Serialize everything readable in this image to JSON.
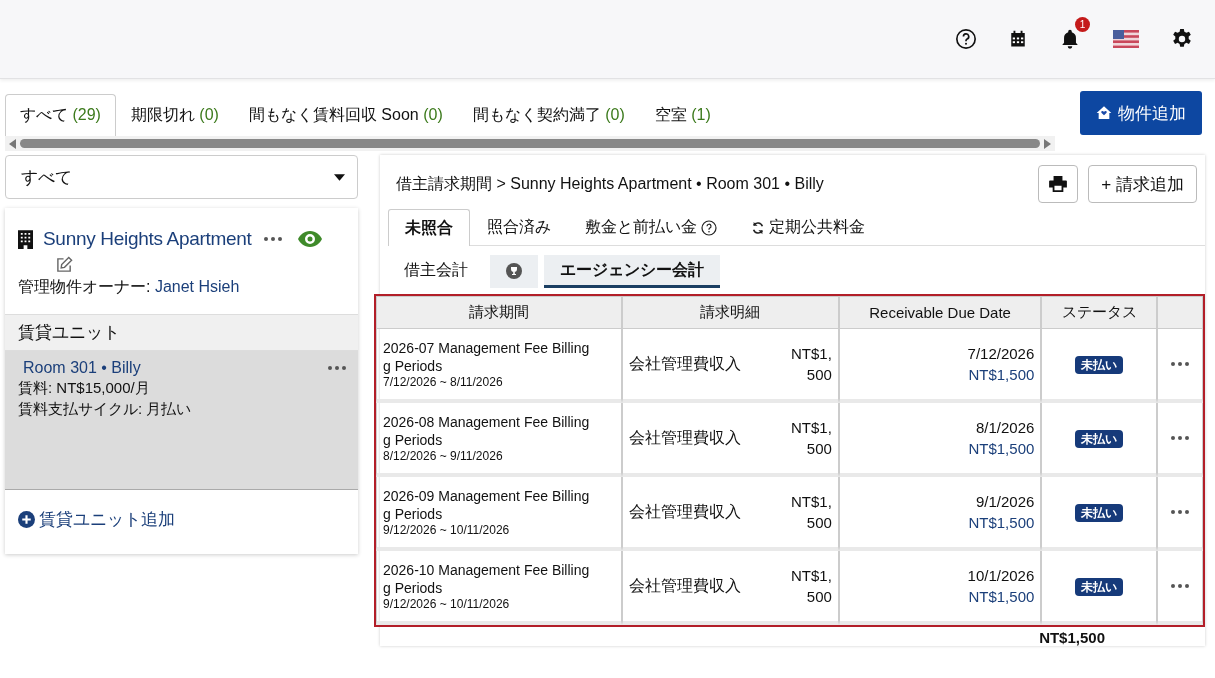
{
  "header": {
    "notification_count": "1"
  },
  "filter_tabs": [
    {
      "label": "すべて",
      "count": "(29)",
      "selected": true
    },
    {
      "label": "期限切れ",
      "count": "(0)",
      "selected": false
    },
    {
      "label": "間もなく賃料回収 Soon",
      "count": "(0)",
      "selected": false
    },
    {
      "label": "間もなく契約満了",
      "count": "(0)",
      "selected": false
    },
    {
      "label": "空室",
      "count": "(1)",
      "selected": false
    }
  ],
  "add_property_button": "物件追加",
  "sidebar": {
    "filter_select": {
      "value": "すべて"
    },
    "property": {
      "name": "Sunny Heights Apartment",
      "owner_label": "管理物件オーナー:",
      "owner_name": "Janet Hsieh",
      "visible": true
    },
    "units_heading": "賃貸ユニット",
    "units": [
      {
        "title": "Room 301 • Billy",
        "rent": "賃料: NT$15,000/月",
        "cycle": "賃料支払サイクル: 月払い",
        "selected": true
      }
    ],
    "add_unit_link": "賃貸ユニット追加"
  },
  "panel": {
    "breadcrumb": "借主請求期間 > Sunny Heights Apartment • Room 301 • Billy",
    "add_bill_button": "+ 請求追加",
    "tabs": [
      {
        "label": "未照合",
        "kind": "plain",
        "selected": true
      },
      {
        "label": "照合済み",
        "kind": "plain",
        "selected": false
      },
      {
        "label": "敷金と前払い金",
        "kind": "help",
        "selected": false
      },
      {
        "label": "定期公共料金",
        "kind": "refresh",
        "selected": false
      }
    ],
    "subtabs": [
      {
        "label": "借主会計",
        "kind": "text",
        "selected": false
      },
      {
        "kind": "icon",
        "selected": false
      },
      {
        "label": "エージェンシー会計",
        "kind": "text",
        "selected": true
      }
    ],
    "table": {
      "columns": [
        "請求期間",
        "請求明細",
        "Receivable Due Date",
        "ステータス"
      ],
      "rows": [
        {
          "title": "2026-07 Management Fee Billing\ng Periods",
          "range": "7/12/2026 ~ 8/11/2026",
          "item": "会社管理費収入",
          "amount": "NT$1,\n500",
          "due_date": "7/12/2026",
          "due_amount": "NT$1,500",
          "status": "未払い"
        },
        {
          "title": "2026-08 Management Fee Billing\ng Periods",
          "range": "8/12/2026 ~ 9/11/2026",
          "item": "会社管理費収入",
          "amount": "NT$1,\n500",
          "due_date": "8/1/2026",
          "due_amount": "NT$1,500",
          "status": "未払い"
        },
        {
          "title": "2026-09 Management Fee Billing\ng Periods",
          "range": "9/12/2026 ~ 10/11/2026",
          "item": "会社管理費収入",
          "amount": "NT$1,\n500",
          "due_date": "9/1/2026",
          "due_amount": "NT$1,500",
          "status": "未払い"
        },
        {
          "title": "2026-10 Management Fee Billing\ng Periods",
          "range": "9/12/2026 ~ 10/11/2026",
          "item": "会社管理費収入",
          "amount": "NT$1,\n500",
          "due_date": "10/1/2026",
          "due_amount": "NT$1,500",
          "status": "未払い"
        }
      ]
    },
    "total": "NT$1,500"
  }
}
